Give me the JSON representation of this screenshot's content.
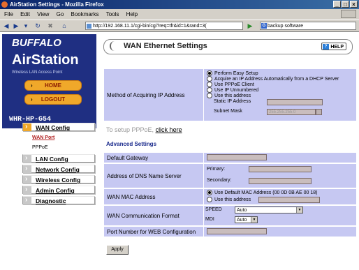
{
  "window": {
    "title": "AirStation Settings - Mozilla Firefox",
    "controls": [
      "_",
      "□",
      "×"
    ]
  },
  "menubar": [
    "File",
    "Edit",
    "View",
    "Go",
    "Bookmarks",
    "Tools",
    "Help"
  ],
  "navbar": {
    "url": "http://192.168.11.1/cgi-bin/cgi?req=tfr&id=1&rand=3(",
    "search": "backup software"
  },
  "sidebar": {
    "brand": "BUFFALO",
    "product": "AirStation",
    "tagline": "Wireless LAN Access Point",
    "home": "HOME",
    "logout": "LOGOUT",
    "model": "WHR-HP-G54",
    "menu": [
      {
        "label": "WAN Config",
        "active": true
      },
      {
        "label": "LAN Config"
      },
      {
        "label": "Network Config"
      },
      {
        "label": "Wireless Config"
      },
      {
        "label": "Admin Config"
      },
      {
        "label": "Diagnostic"
      }
    ],
    "submenu": [
      "WAN Port",
      "PPPoE"
    ]
  },
  "main": {
    "title": "WAN Ethernet Settings",
    "help": "HELP",
    "method_label": "Method of Acquiring IP Address",
    "method_options": [
      "Perform Easy Setup",
      "Acquire an IP Address Automatically from a DHCP Server",
      "Use PPPoE Client",
      "Use IP Unnumbered",
      "Use this address"
    ],
    "static_ip_label": "Static IP Address",
    "subnet_label": "Subnet Mask",
    "subnet_value": "255.255.255.0",
    "pppoe_text": "To setup PPPoE,",
    "pppoe_link": "click here",
    "advanced": "Advanced Settings",
    "gateway_label": "Default Gateway",
    "dns_label": "Address of DNS Name Server",
    "primary_label": "Primary:",
    "secondary_label": "Secondary:",
    "mac_label": "WAN MAC Address",
    "mac_default": "Use Default MAC Address (00 0D 0B AE 00 18)",
    "mac_custom": "Use this address",
    "comm_label": "WAN Communication Format",
    "speed_label": "SPEED",
    "speed_value": "Auto",
    "mdi_label": "MDI",
    "mdi_value": "Auto",
    "port_label": "Port Number for WEB Configuration",
    "apply": "Apply"
  }
}
